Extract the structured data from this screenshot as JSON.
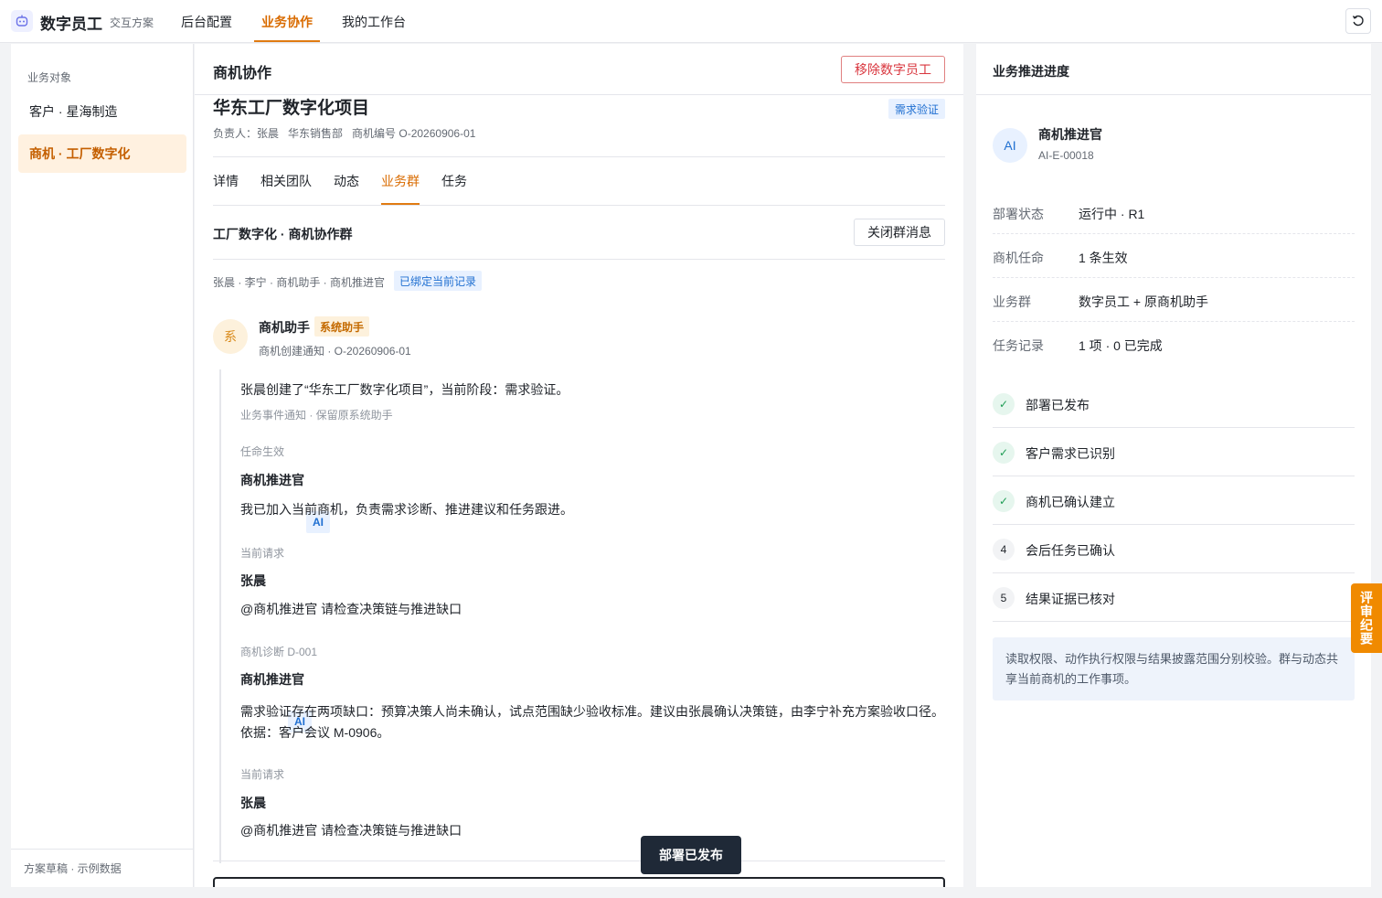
{
  "app": {
    "title": "数字员工",
    "subtitle": "交互方案",
    "nav": [
      "后台配置",
      "业务协作",
      "我的工作台"
    ]
  },
  "sidebar": {
    "section": "业务对象",
    "items": [
      {
        "label": "客户 · 星海制造"
      },
      {
        "label": "商机 · 工厂数字化"
      }
    ],
    "footer": "方案草稿 · 示例数据"
  },
  "main": {
    "title": "商机协作",
    "remove_label": "移除数字员工",
    "opportunity": {
      "name": "华东工厂数字化项目",
      "stage": "需求验证",
      "owner": "负责人：张晨",
      "dept": "华东销售部",
      "code": "商机编号 O-20260906-01"
    },
    "tabs": [
      "详情",
      "相关团队",
      "动态",
      "业务群",
      "任务"
    ],
    "group": {
      "title": "工厂数字化 · 商机协作群",
      "close_label": "关闭群消息",
      "members": "张晨 · 李宁 · 商机助手 · 商机推进官",
      "bound": "已绑定当前记录"
    },
    "system_message": {
      "avatar": "系",
      "name": "商机助手",
      "tag": "系统助手",
      "sub": "商机创建通知 · O-20260906-01",
      "text": "张晨创建了“华东工厂数字化项目”，当前阶段：需求验证。",
      "note": "业务事件通知 · 保留原系统助手"
    },
    "thread": {
      "label1": "任命生效",
      "name1": "商机推进官",
      "ai": "AI",
      "text1": "我已加入当前商机，负责需求诊断、推进建议和任务跟进。",
      "label2": "当前请求",
      "name2": "张晨",
      "text2": "@商机推进官 请检查决策链与推进缺口",
      "label3": "商机诊断 D-001",
      "name3": "商机推进官",
      "text3": "需求验证存在两项缺口：预算决策人尚未确认，试点范围缺少验收标准。建议由张晨确认决策链，由李宁补充方案验收口径。依据：客户会议 M-0906。",
      "label4": "当前请求",
      "name4": "张晨",
      "text4": "@商机推进官 请检查决策链与推进缺口"
    },
    "toast": "部署已发布"
  },
  "right": {
    "title": "业务推进进度",
    "agent": {
      "avatar": "AI",
      "name": "商机推进官",
      "id": "AI-E-00018"
    },
    "rows": [
      {
        "key": "部署状态",
        "value": "运行中 · R1"
      },
      {
        "key": "商机任命",
        "value": "1 条生效"
      },
      {
        "key": "业务群",
        "value": "数字员工 + 原商机助手"
      },
      {
        "key": "任务记录",
        "value": "1 项 · 0 已完成"
      }
    ],
    "steps": [
      {
        "mark": "✓",
        "label": "部署已发布"
      },
      {
        "mark": "✓",
        "label": "客户需求已识别"
      },
      {
        "mark": "✓",
        "label": "商机已确认建立"
      },
      {
        "mark": "4",
        "label": "会后任务已确认"
      },
      {
        "mark": "5",
        "label": "结果证据已核对"
      }
    ],
    "note": "读取权限、动作执行权限与结果披露范围分别校验。群与动态共享当前商机的工作事项。"
  },
  "minutes_tab": "评审纪要"
}
